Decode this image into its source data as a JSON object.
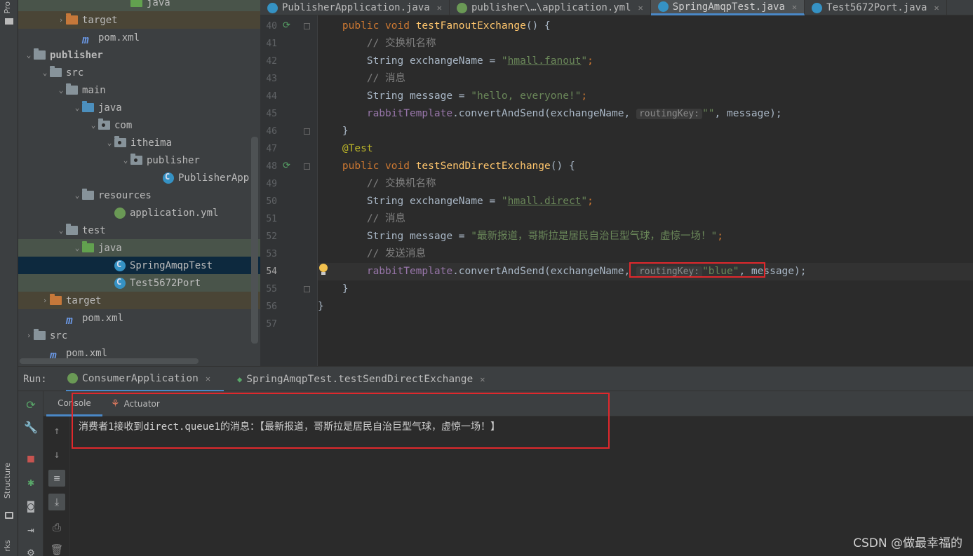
{
  "left_strip": {
    "top_label": "Pro",
    "structure_label": "Structure",
    "bottom_label": "rks"
  },
  "project_tree": [
    {
      "label": "java",
      "indent": 7,
      "arrow": "",
      "icon": "folder green",
      "cls": "hl-test"
    },
    {
      "label": "target",
      "indent": 3,
      "arrow": "›",
      "icon": "folder orange",
      "cls": "hl-target"
    },
    {
      "label": "pom.xml",
      "indent": 4,
      "arrow": "",
      "icon": "mvn",
      "cls": ""
    },
    {
      "label": "publisher",
      "indent": 1,
      "arrow": "⌄",
      "icon": "folder",
      "cls": "",
      "bold": true
    },
    {
      "label": "src",
      "indent": 2,
      "arrow": "⌄",
      "icon": "folder",
      "cls": ""
    },
    {
      "label": "main",
      "indent": 3,
      "arrow": "⌄",
      "icon": "folder",
      "cls": ""
    },
    {
      "label": "java",
      "indent": 4,
      "arrow": "⌄",
      "icon": "folder blue",
      "cls": ""
    },
    {
      "label": "com",
      "indent": 5,
      "arrow": "⌄",
      "icon": "folder pkg",
      "cls": ""
    },
    {
      "label": "itheima",
      "indent": 6,
      "arrow": "⌄",
      "icon": "folder pkg",
      "cls": ""
    },
    {
      "label": "publisher",
      "indent": 7,
      "arrow": "⌄",
      "icon": "folder pkg",
      "cls": ""
    },
    {
      "label": "PublisherApp",
      "indent": 9,
      "arrow": "",
      "icon": "cls",
      "cls": ""
    },
    {
      "label": "resources",
      "indent": 4,
      "arrow": "⌄",
      "icon": "folder res",
      "cls": ""
    },
    {
      "label": "application.yml",
      "indent": 6,
      "arrow": "",
      "icon": "yml",
      "cls": ""
    },
    {
      "label": "test",
      "indent": 3,
      "arrow": "⌄",
      "icon": "folder",
      "cls": ""
    },
    {
      "label": "java",
      "indent": 4,
      "arrow": "⌄",
      "icon": "folder green",
      "cls": "hl-test"
    },
    {
      "label": "SpringAmqpTest",
      "indent": 6,
      "arrow": "",
      "icon": "cls",
      "cls": "sel"
    },
    {
      "label": "Test5672Port",
      "indent": 6,
      "arrow": "",
      "icon": "cls",
      "cls": "hl-test"
    },
    {
      "label": "target",
      "indent": 2,
      "arrow": "›",
      "icon": "folder orange",
      "cls": "hl-target"
    },
    {
      "label": "pom.xml",
      "indent": 3,
      "arrow": "",
      "icon": "mvn",
      "cls": ""
    },
    {
      "label": "src",
      "indent": 1,
      "arrow": "›",
      "icon": "folder",
      "cls": ""
    },
    {
      "label": "pom.xml",
      "indent": 2,
      "arrow": "",
      "icon": "mvn",
      "cls": ""
    }
  ],
  "editor_tabs": [
    {
      "label": "PublisherApplication.java",
      "icon": "cls",
      "active": false
    },
    {
      "label": "publisher\\…\\application.yml",
      "icon": "yml",
      "active": false
    },
    {
      "label": "SpringAmqpTest.java",
      "icon": "cls",
      "active": true
    },
    {
      "label": "Test5672Port.java",
      "icon": "cls",
      "active": false
    }
  ],
  "line_numbers": [
    "40",
    "41",
    "42",
    "43",
    "44",
    "45",
    "46",
    "47",
    "48",
    "49",
    "50",
    "51",
    "52",
    "53",
    "54",
    "55",
    "56",
    "57"
  ],
  "current_line": "54",
  "code": {
    "l40_kw": "public void ",
    "l40_fn": "testFanoutExchange",
    "l40_rest": "() {",
    "l41": "// 交换机名称",
    "l42_a": "String exchangeName = ",
    "l42_q1": "\"",
    "l42_s": "hmall.fanout",
    "l42_q2": "\"",
    "l42_e": ";",
    "l43": "// 消息",
    "l44_a": "String message = ",
    "l44_s": "\"hello, everyone!\"",
    "l44_e": ";",
    "l45_f": "rabbitTemplate",
    "l45_a": ".convertAndSend(exchangeName, ",
    "l45_h": "routingKey:",
    "l45_s": "\"\"",
    "l45_e": ", message);",
    "l46": "}",
    "l47": "@Test",
    "l48_kw": "public void ",
    "l48_fn": "testSendDirectExchange",
    "l48_rest": "() {",
    "l49": "// 交换机名称",
    "l50_a": "String exchangeName = ",
    "l50_q1": "\"",
    "l50_s": "hmall.direct",
    "l50_q2": "\"",
    "l50_e": ";",
    "l51": "// 消息",
    "l52_a": "String message = ",
    "l52_s": "\"最新报道，哥斯拉是居民自治巨型气球，虚惊一场！\"",
    "l52_e": ";",
    "l53": "// 发送消息",
    "l54_f": "rabbitTemplate",
    "l54_a": ".convertAndSend(exchangeName, ",
    "l54_h": "routingKey:",
    "l54_s": "\"blue\"",
    "l54_e": ", message);",
    "l55": "}",
    "l56": "}"
  },
  "run_panel": {
    "label": "Run:",
    "tabs": [
      {
        "label": "ConsumerApplication",
        "active": true
      },
      {
        "label": "SpringAmqpTest.testSendDirectExchange",
        "active": false
      }
    ],
    "sub_tabs": [
      {
        "label": "Console",
        "active": true
      },
      {
        "label": "Actuator",
        "active": false
      }
    ],
    "console_output": "消费者1接收到direct.queue1的消息：【最新报道，哥斯拉是居民自治巨型气球，虚惊一场！】"
  },
  "watermark": "CSDN @做最幸福的",
  "colors": {
    "highlight_box": "#e0282c",
    "accent": "#4a88c7"
  }
}
